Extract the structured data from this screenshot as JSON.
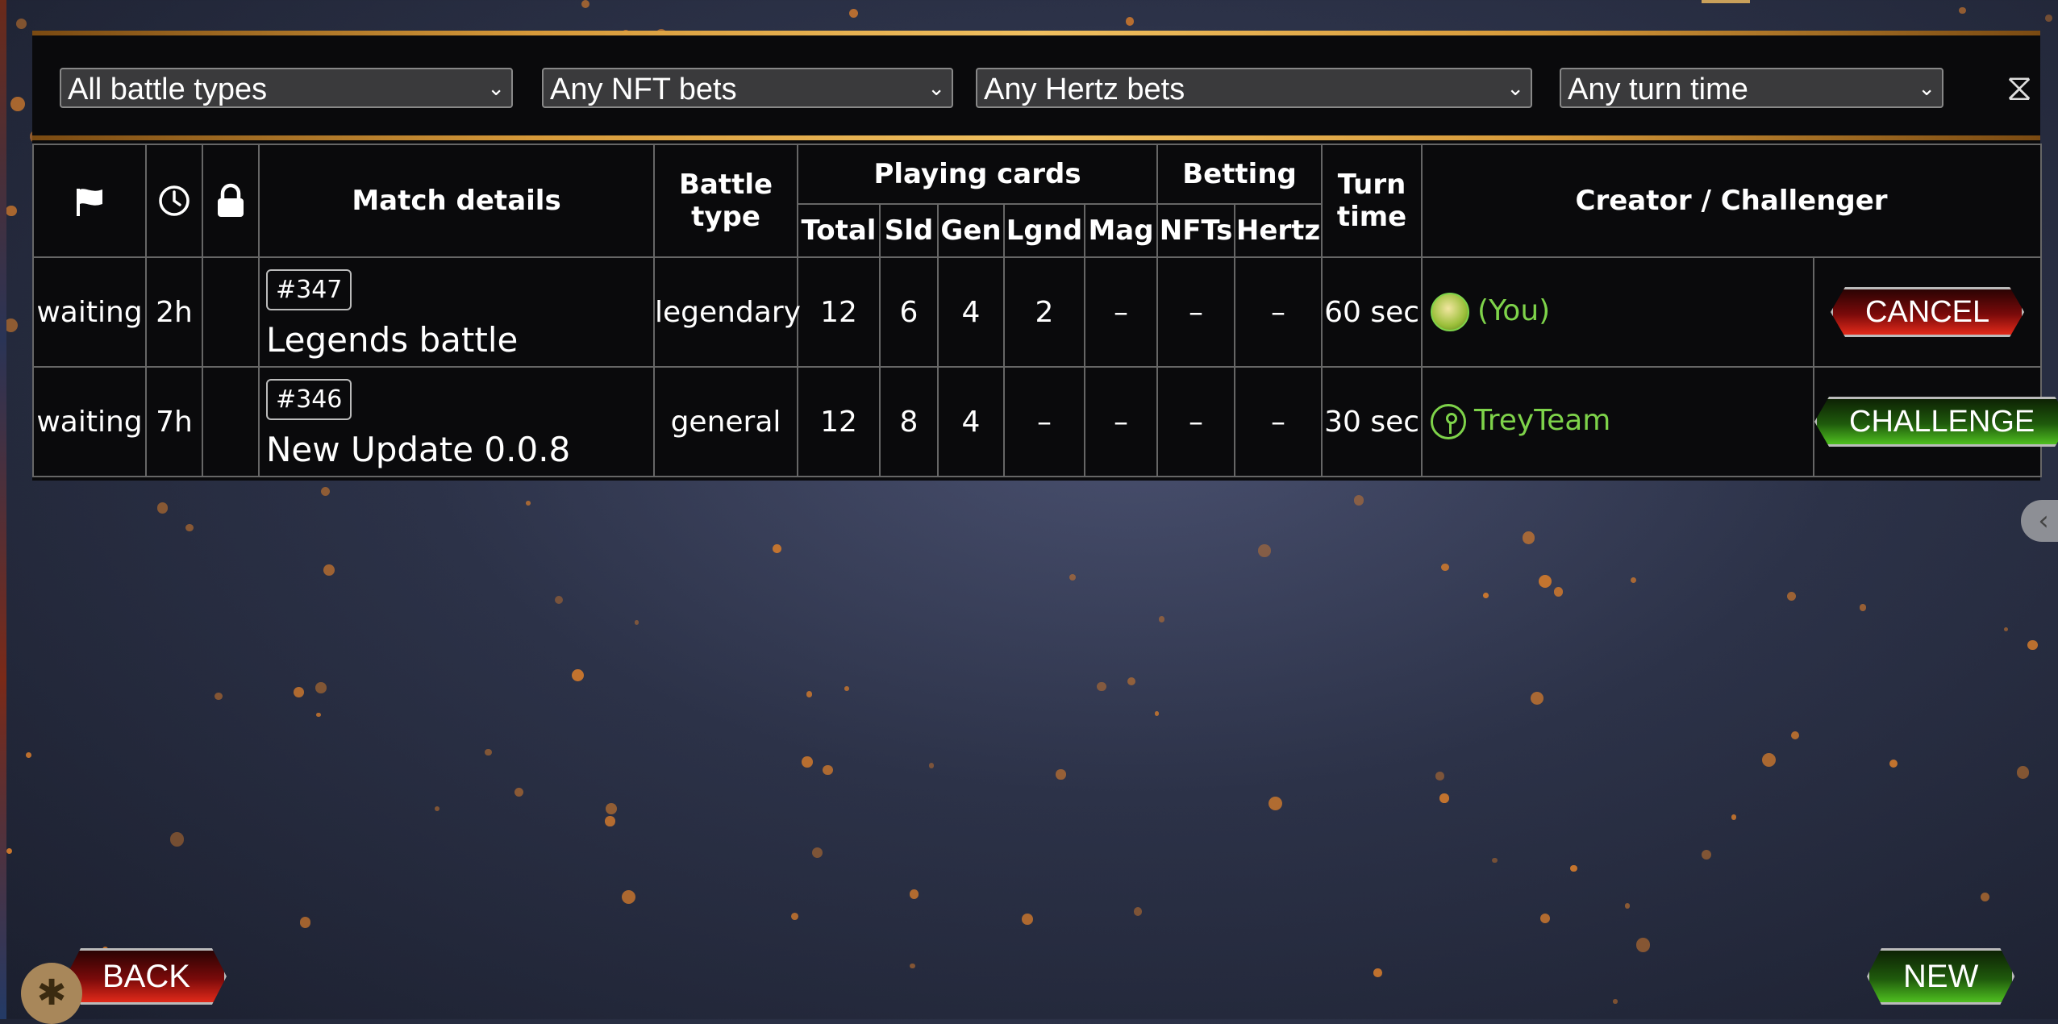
{
  "filters": {
    "battle_types": "All battle types",
    "nft_bets": "Any NFT bets",
    "hertz_bets": "Any Hertz bets",
    "turn_time": "Any turn time"
  },
  "table": {
    "headers": {
      "match_details": "Match details",
      "battle_type": "Battle type",
      "playing_cards": "Playing cards",
      "betting": "Betting",
      "turn_time": "Turn time",
      "creator_challenger": "Creator / Challenger",
      "total": "Total",
      "sld": "Sld",
      "gen": "Gen",
      "lgnd": "Lgnd",
      "mag": "Mag",
      "nfts": "NFTs",
      "hertz": "Hertz"
    },
    "rows": [
      {
        "status": "waiting",
        "age": "2h",
        "id": "#347",
        "name": "Legends battle",
        "battle_type": "legendary",
        "total": "12",
        "sld": "6",
        "gen": "4",
        "lgnd": "2",
        "mag": "–",
        "nfts": "–",
        "hertz": "–",
        "turn_time": "60 sec",
        "creator": "(You)",
        "action": "CANCEL"
      },
      {
        "status": "waiting",
        "age": "7h",
        "id": "#346",
        "name": "New Update 0.0.8",
        "battle_type": "general",
        "total": "12",
        "sld": "8",
        "gen": "4",
        "lgnd": "–",
        "mag": "–",
        "nfts": "–",
        "hertz": "–",
        "turn_time": "30 sec",
        "creator": "TreyTeam",
        "action": "CHALLENGE"
      }
    ]
  },
  "footer": {
    "back": "BACK",
    "new": "NEW"
  },
  "icons": [
    "flag-icon",
    "clock-icon",
    "lock-icon",
    "hourglass-icon",
    "bug-icon",
    "chevron-left-icon"
  ],
  "colors": {
    "accent_green": "#7ed34a",
    "cancel_red": "#b01010",
    "gold": "#d79a3a"
  }
}
